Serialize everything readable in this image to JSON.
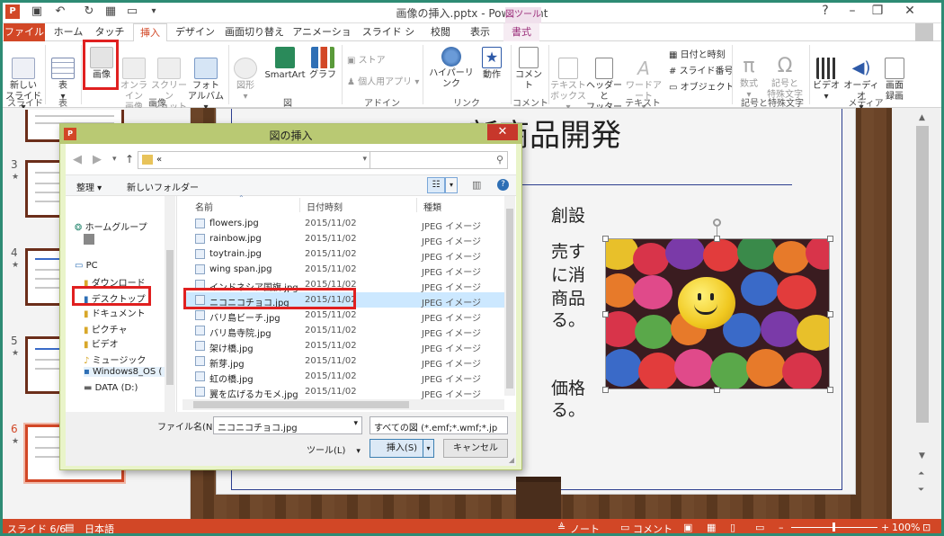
{
  "app": {
    "title": "画像の挿入.pptx - PowerPoint",
    "context_group": "図ツール",
    "win_min": "?",
    "win_restore": "–",
    "win_max": "❐",
    "win_close": "✕"
  },
  "tabs": [
    "ファイル",
    "ホーム",
    "タッチ",
    "挿入",
    "デザイン",
    "画面切り替え",
    "アニメーション",
    "スライド ショー",
    "校閲",
    "表示",
    "書式"
  ],
  "ribbon": {
    "new_slide": "新しい\nスライド ▾",
    "table": "表\n▾",
    "picture": "画像",
    "online_picture": "オンライン\n画像",
    "screenshot": "スクリーン\nショット ▾",
    "photo_album": "フォト\nアルバム ▾",
    "shapes": "図形\n▾",
    "smartart": "SmartArt",
    "chart": "グラフ",
    "store": "ストア",
    "my_apps": "個人用アプリ ▾",
    "hyperlink": "ハイパーリンク",
    "action": "動作",
    "comment": "コメント",
    "textbox": "テキスト\nボックス ▾",
    "header_footer": "ヘッダーと\nフッター",
    "wordart": "ワードアート\n▾",
    "datetime": "日付と時刻",
    "slide_number": "スライド番号",
    "object": "オブジェクト",
    "equation": "数式\n▾",
    "symbol": "記号と\n特殊文字",
    "video": "ビデオ\n▾",
    "audio": "オーディオ\n▾",
    "screen_record": "画面\n録画",
    "groups": {
      "slides": "スライド",
      "tables": "表",
      "images": "画像",
      "illustrations": "図",
      "apps": "アドイン",
      "links": "リンク",
      "comments": "コメント",
      "text": "テキスト",
      "symbols": "記号と特殊文字",
      "media": "メディア"
    }
  },
  "slides_pane": {
    "numbers": [
      "3",
      "4",
      "5",
      "6"
    ],
    "star": "★"
  },
  "slide": {
    "title": "新商品開発",
    "line1": "創設",
    "line2": "売す",
    "line3": "に消",
    "line4": "商品",
    "line5": "る。",
    "line6": "価格",
    "line7": "る。"
  },
  "dialog": {
    "title": "図の挿入",
    "close": "✕",
    "address": "«",
    "organize": "整理 ▾",
    "new_folder": "新しいフォルダー",
    "nav": {
      "homegroup": "ホームグループ",
      "pc": "PC",
      "download": "ダウンロード",
      "desktop": "デスクトップ",
      "documents": "ドキュメント",
      "pictures": "ピクチャ",
      "videos": "ビデオ",
      "music": "ミュージック",
      "windows": "Windows8_OS (",
      "data": "DATA (D:)"
    },
    "columns": {
      "name": "名前",
      "date": "日付時刻",
      "type": "種類"
    },
    "files": [
      {
        "name": "flowers.jpg",
        "date": "2015/11/02",
        "type": "JPEG イメージ"
      },
      {
        "name": "rainbow.jpg",
        "date": "2015/11/02",
        "type": "JPEG イメージ"
      },
      {
        "name": "toytrain.jpg",
        "date": "2015/11/02",
        "type": "JPEG イメージ"
      },
      {
        "name": "wing span.jpg",
        "date": "2015/11/02",
        "type": "JPEG イメージ"
      },
      {
        "name": "インドネシア国旗.jpg",
        "date": "2015/11/02",
        "type": "JPEG イメージ"
      },
      {
        "name": "ニコニコチョコ.jpg",
        "date": "2015/11/02",
        "type": "JPEG イメージ"
      },
      {
        "name": "バリ島ビーチ.jpg",
        "date": "2015/11/02",
        "type": "JPEG イメージ"
      },
      {
        "name": "バリ島寺院.jpg",
        "date": "2015/11/02",
        "type": "JPEG イメージ"
      },
      {
        "name": "架け橋.jpg",
        "date": "2015/11/02",
        "type": "JPEG イメージ"
      },
      {
        "name": "新芽.jpg",
        "date": "2015/11/02",
        "type": "JPEG イメージ"
      },
      {
        "name": "虹の橋.jpg",
        "date": "2015/11/02",
        "type": "JPEG イメージ"
      },
      {
        "name": "翼を広げるカモメ.jpg",
        "date": "2015/11/02",
        "type": "JPEG イメージ"
      }
    ],
    "filename_label": "ファイル名(N):",
    "filename_value": "ニコニコチョコ.jpg",
    "filetype_value": "すべての図 (*.emf;*.wmf;*.jp",
    "tools": "ツール(L)",
    "insert": "挿入(S)",
    "cancel": "キャンセル"
  },
  "status": {
    "slide": "スライド 6/6",
    "lang": "日本語",
    "notes": "ノート",
    "comments": "コメント",
    "zoom": "100%"
  },
  "colors": {
    "accent": "#d24726",
    "dialog": "#e9f4c9",
    "frame": "#2e8b74"
  }
}
